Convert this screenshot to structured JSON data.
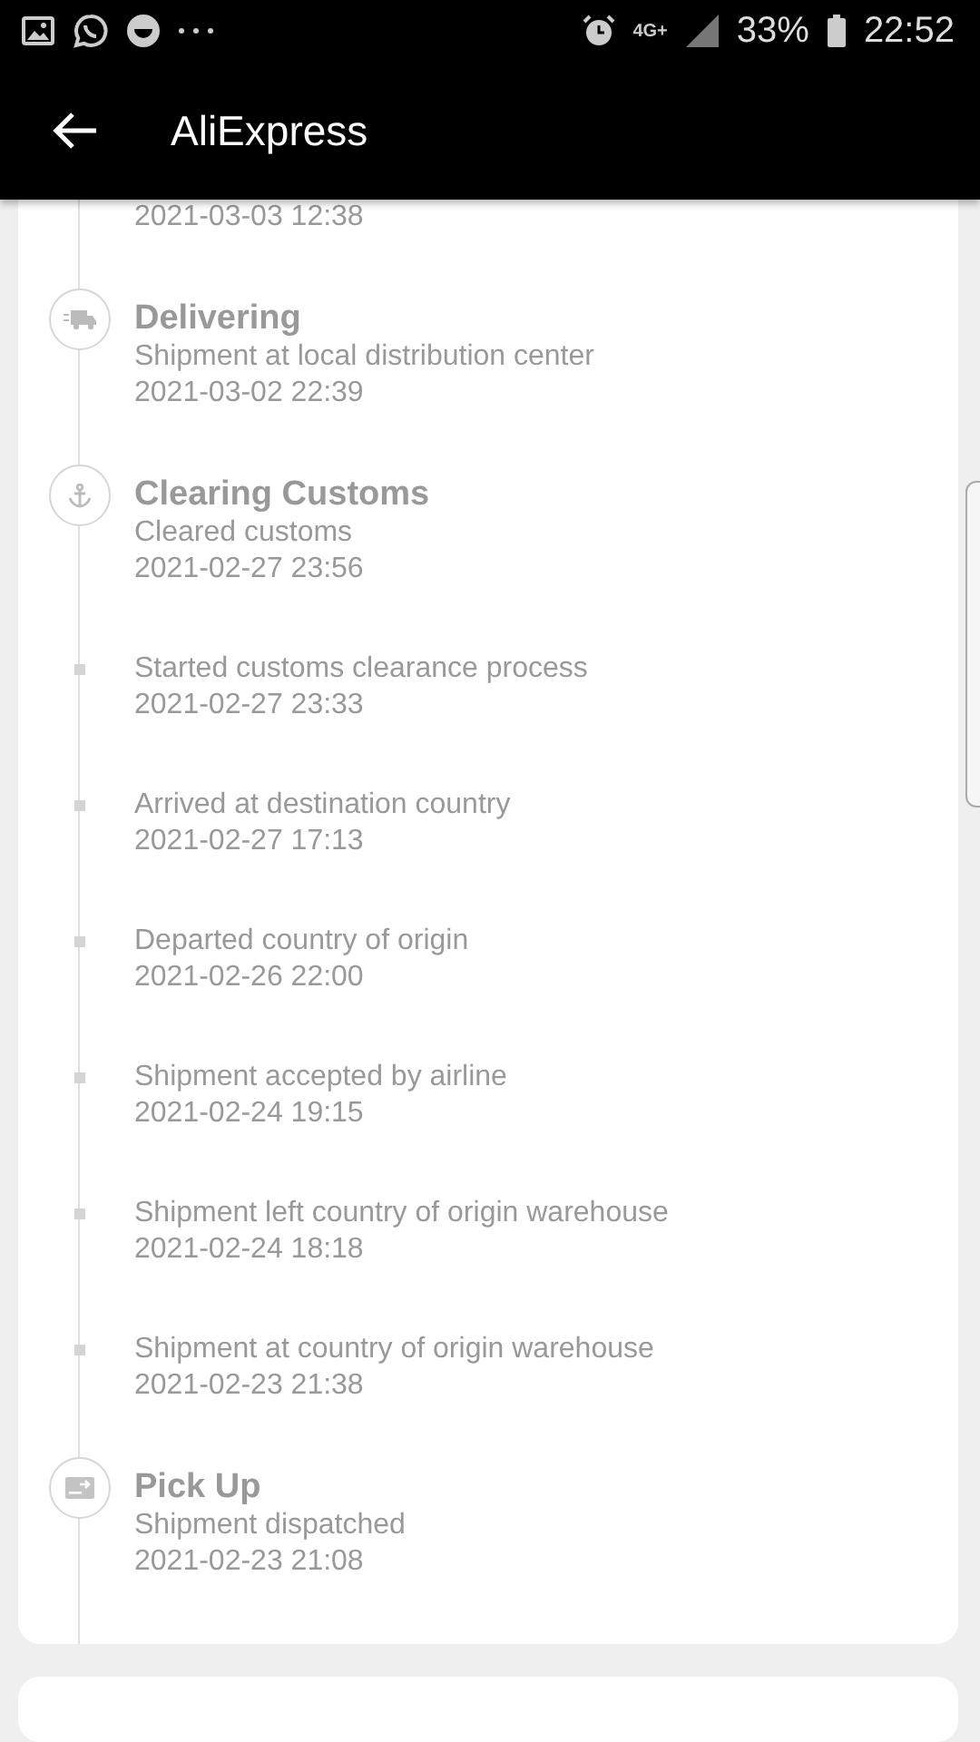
{
  "status_bar": {
    "battery": "33%",
    "time": "22:52",
    "network": "4G+"
  },
  "app_bar": {
    "title": "AliExpress"
  },
  "events": [
    {
      "kind": "continued",
      "date": "2021-03-03 12:38"
    },
    {
      "kind": "delivery",
      "title": "Delivering",
      "text": "Shipment at local distribution center",
      "date": "2021-03-02 22:39"
    },
    {
      "kind": "customs",
      "title": "Clearing Customs",
      "text": "Cleared customs",
      "date": "2021-02-27 23:56"
    },
    {
      "kind": "step",
      "text": "Started customs clearance process",
      "date": "2021-02-27 23:33"
    },
    {
      "kind": "step",
      "text": "Arrived at destination country",
      "date": "2021-02-27 17:13"
    },
    {
      "kind": "step",
      "text": "Departed country of origin",
      "date": "2021-02-26 22:00"
    },
    {
      "kind": "step",
      "text": "Shipment accepted by airline",
      "date": "2021-02-24 19:15"
    },
    {
      "kind": "step",
      "text": "Shipment left country of origin warehouse",
      "date": "2021-02-24 18:18"
    },
    {
      "kind": "step",
      "text": "Shipment at country of origin warehouse",
      "date": "2021-02-23 21:38"
    },
    {
      "kind": "pickup",
      "title": "Pick Up",
      "text": "Shipment dispatched",
      "date": "2021-02-23 21:08"
    }
  ]
}
